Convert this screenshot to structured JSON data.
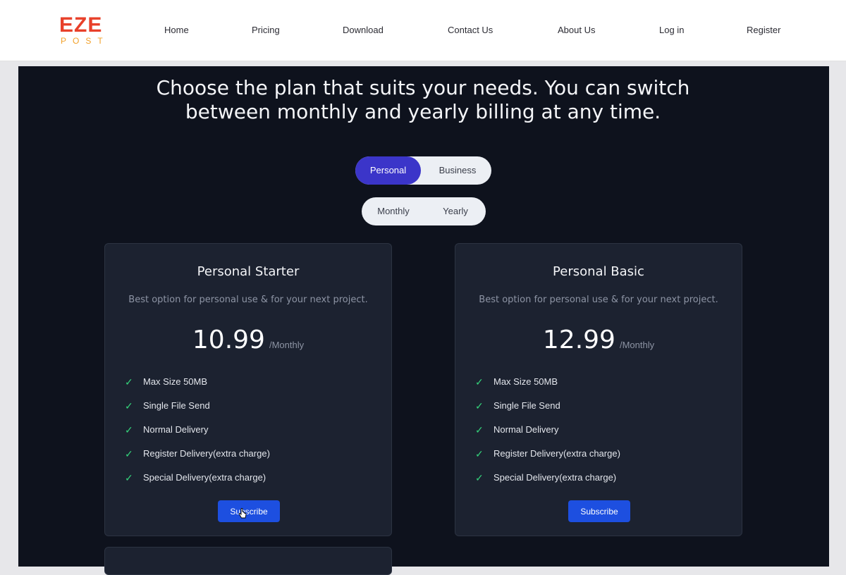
{
  "header": {
    "logo": {
      "main": "EZE",
      "sub": "POST"
    },
    "nav": [
      {
        "label": "Home"
      },
      {
        "label": "Pricing"
      },
      {
        "label": "Download"
      },
      {
        "label": "Contact Us"
      },
      {
        "label": "About Us"
      },
      {
        "label": "Log in"
      },
      {
        "label": "Register"
      }
    ]
  },
  "hero": {
    "headline": "Choose the plan that suits your needs. You can switch between monthly and yearly billing at any time."
  },
  "plan_type_toggle": {
    "options": [
      "Personal",
      "Business"
    ],
    "selected": "Personal"
  },
  "billing_toggle": {
    "options": [
      "Monthly",
      "Yearly"
    ]
  },
  "plans": [
    {
      "title": "Personal Starter",
      "description": "Best option for personal use & for your next project.",
      "price": "10.99",
      "period": "/Monthly",
      "features": [
        "Max Size 50MB",
        "Single File Send",
        "Normal Delivery",
        "Register Delivery(extra charge)",
        "Special Delivery(extra charge)"
      ],
      "cta": "Subscribe"
    },
    {
      "title": "Personal Basic",
      "description": "Best option for personal use & for your next project.",
      "price": "12.99",
      "period": "/Monthly",
      "features": [
        "Max Size 50MB",
        "Single File Send",
        "Normal Delivery",
        "Register Delivery(extra charge)",
        "Special Delivery(extra charge)"
      ],
      "cta": "Subscribe"
    }
  ],
  "icons": {
    "feature_check": "check-icon",
    "pointer": "hand-cursor-icon"
  },
  "colors": {
    "accent": "#3b35c9",
    "button": "#1d4fe0",
    "check": "#34d17a",
    "panel_bg": "#0e121d",
    "card_bg": "#1c2230"
  }
}
